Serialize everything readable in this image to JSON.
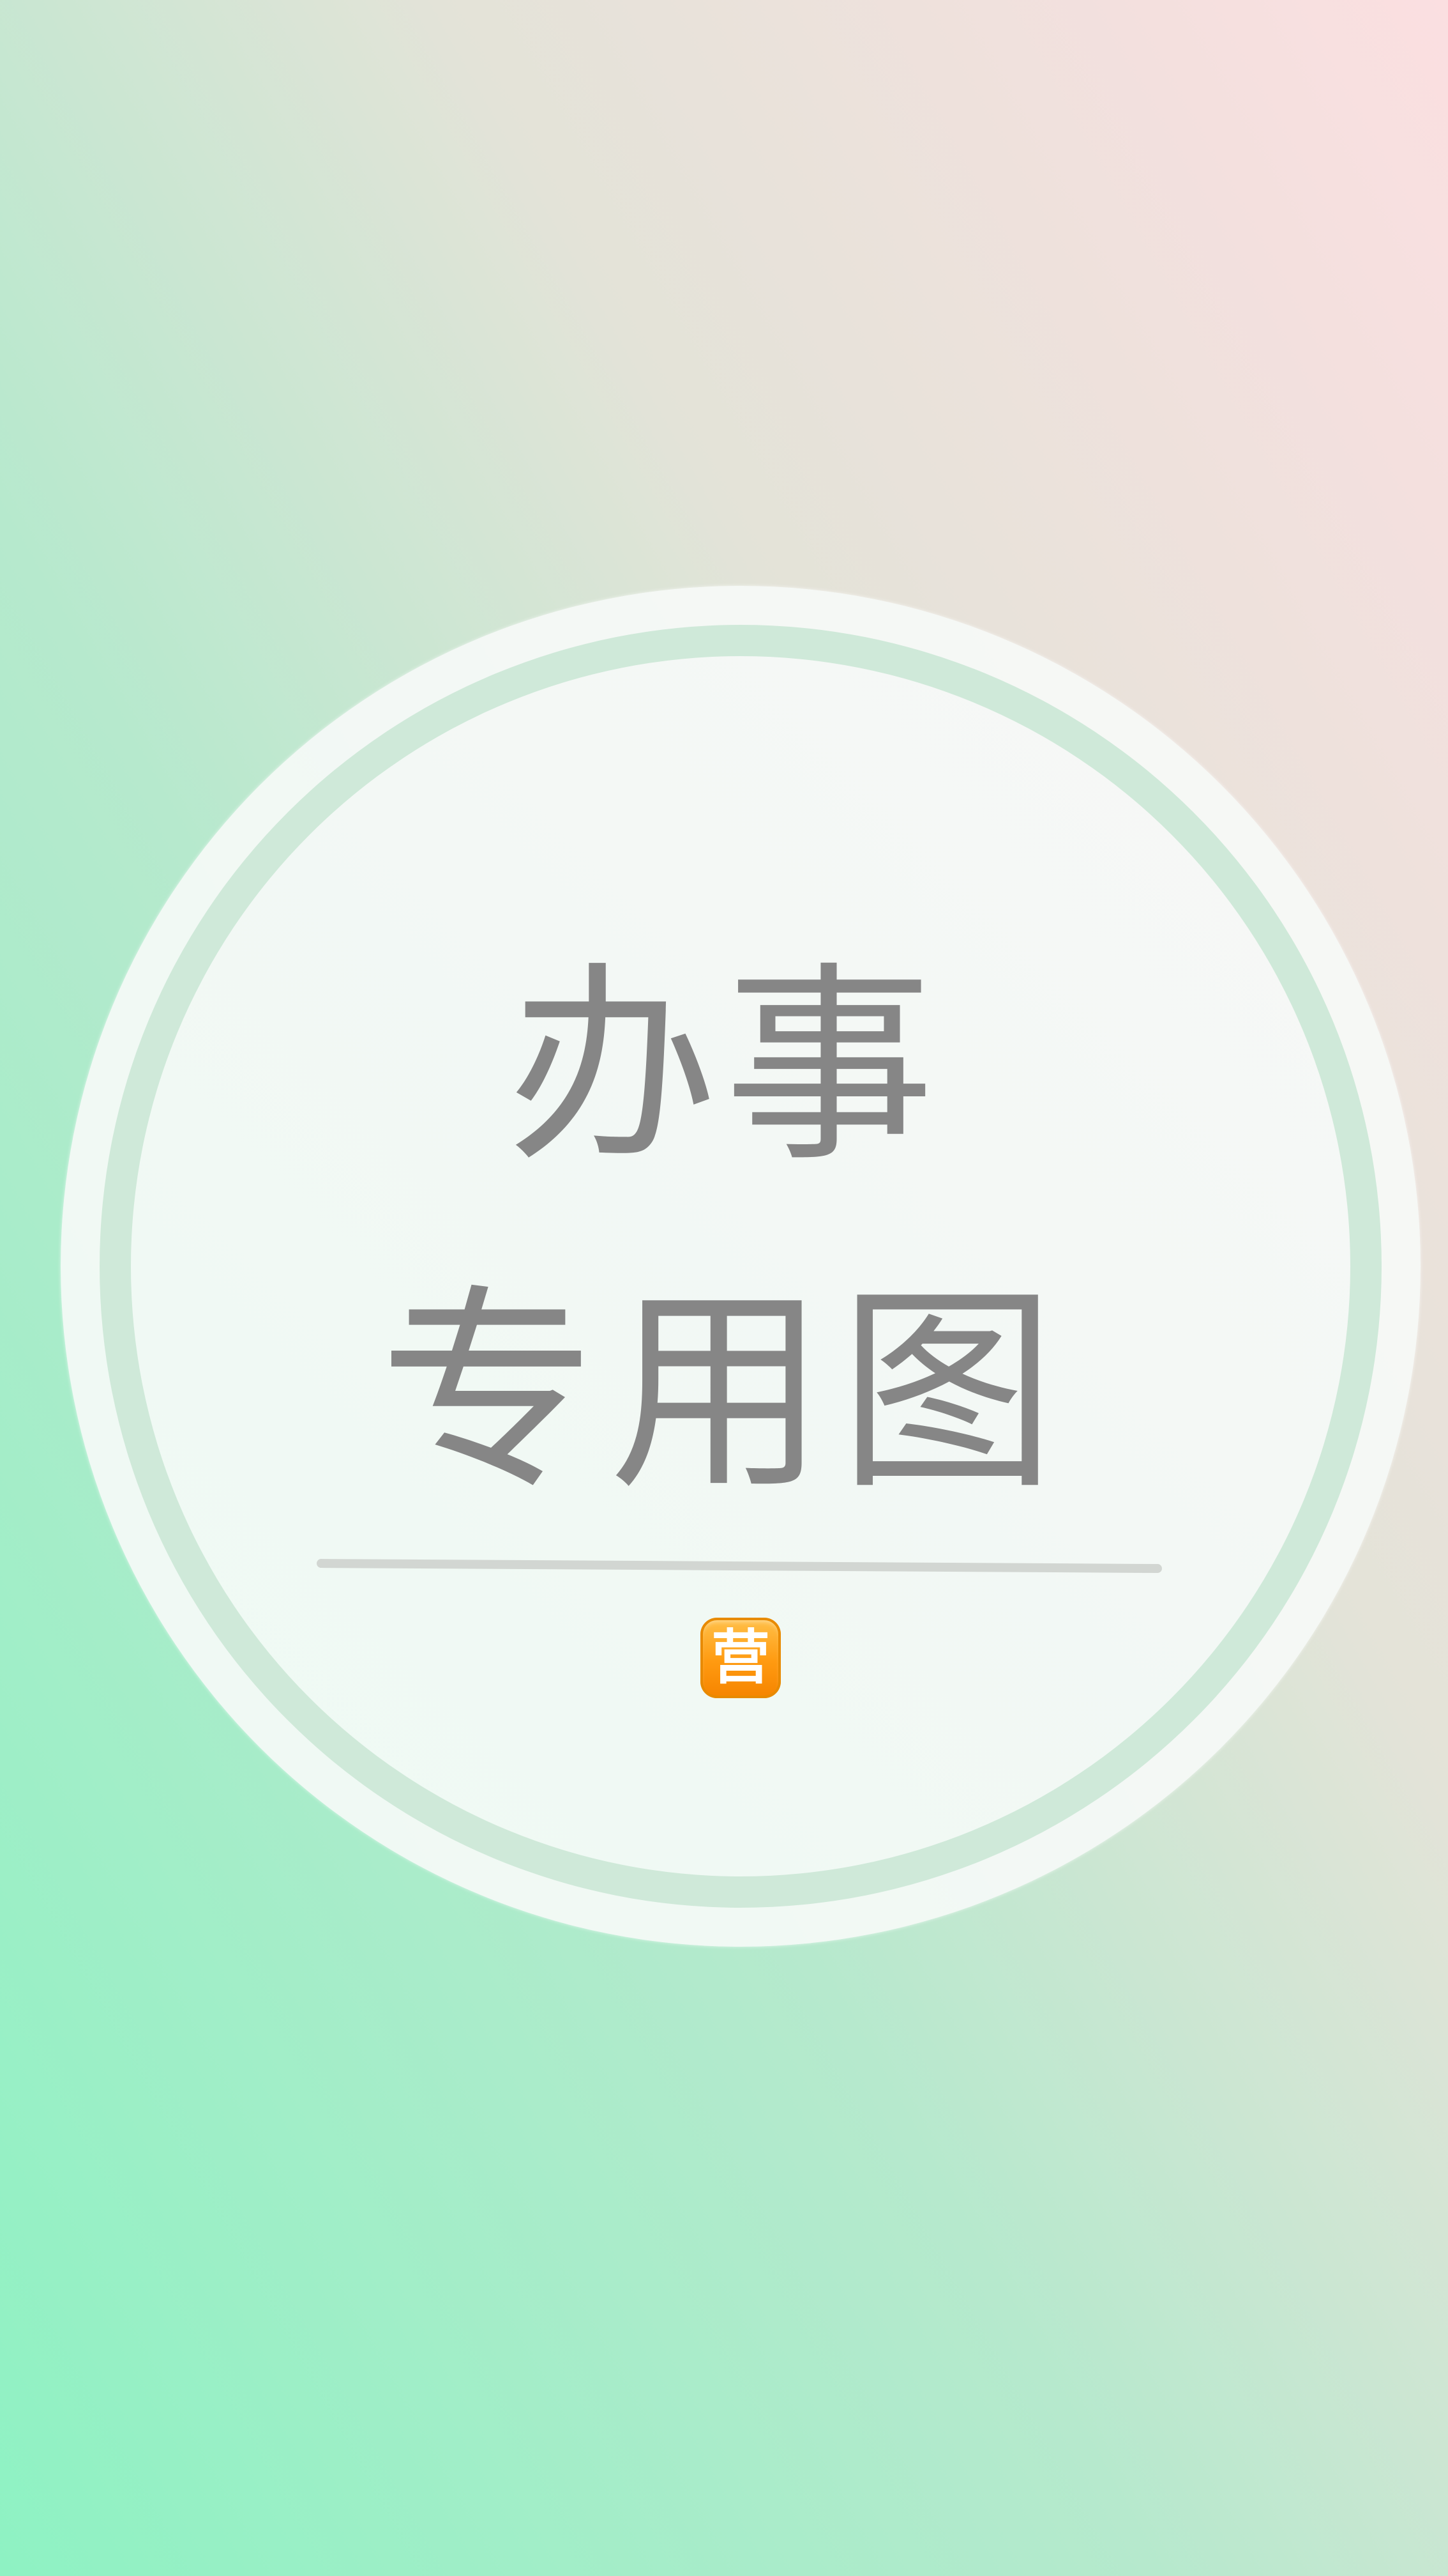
{
  "wallpaper": {
    "title_line_1": "办事",
    "title_line_2": "专用图",
    "badge": {
      "text": "营",
      "icon": "business-open-emoji-icon",
      "color": "#ff9a10"
    }
  },
  "colors": {
    "text": "#868686",
    "ring": "#cfe9d9",
    "gradient_bottom_left": "#8ef2c3",
    "gradient_top_right": "#fbdfe1"
  }
}
